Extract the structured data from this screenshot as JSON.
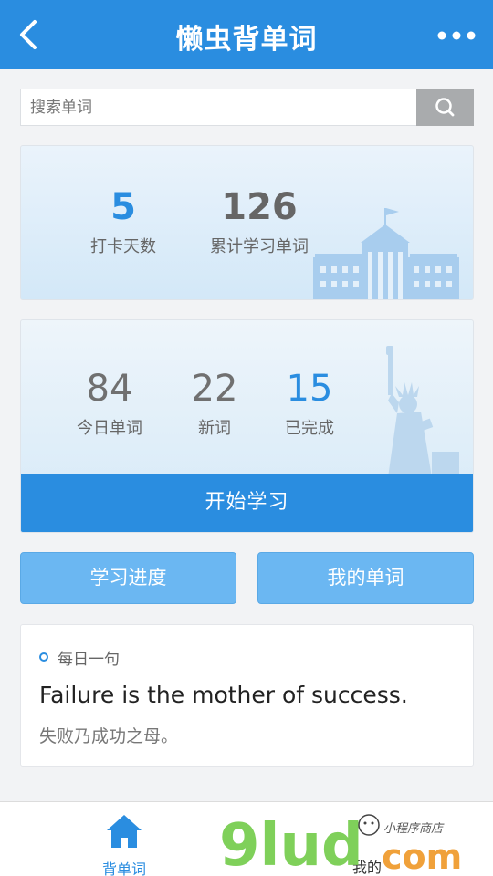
{
  "header": {
    "title": "懒虫背单词"
  },
  "search": {
    "placeholder": "搜索单词"
  },
  "summary": {
    "checkin_days": {
      "value": "5",
      "label": "打卡天数"
    },
    "total_words": {
      "value": "126",
      "label": "累计学习单词"
    }
  },
  "today": {
    "today_words": {
      "value": "84",
      "label": "今日单词"
    },
    "new_words": {
      "value": "22",
      "label": "新词"
    },
    "completed": {
      "value": "15",
      "label": "已完成"
    },
    "start_label": "开始学习"
  },
  "buttons": {
    "progress": "学习进度",
    "my_words": "我的单词"
  },
  "daily_quote": {
    "title": "每日一句",
    "english": "Failure is the mother of success.",
    "chinese": "失败乃成功之母。"
  },
  "tabbar": {
    "home": "背单词",
    "mine": "我的"
  },
  "watermark": {
    "brand": "9lud",
    "suffix": "com",
    "tagline": "小程序商店"
  },
  "colors": {
    "primary": "#2a8de0",
    "button_light": "#6bb7f2",
    "watermark_green": "#7fd05a",
    "watermark_orange": "#f0a13a"
  }
}
